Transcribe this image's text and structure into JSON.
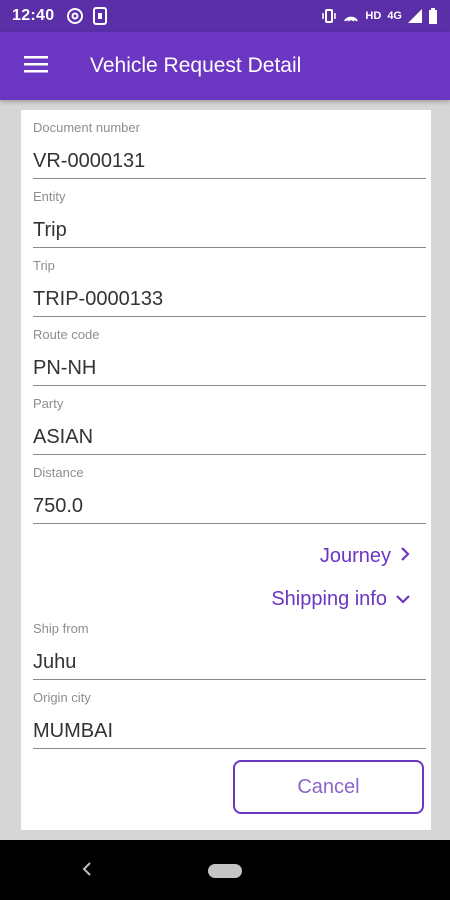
{
  "status": {
    "time": "12:40",
    "network": "HD",
    "network2": "4G"
  },
  "app_bar": {
    "title": "Vehicle Request Detail"
  },
  "fields": [
    {
      "label": "Document number",
      "value": "VR-0000131"
    },
    {
      "label": "Entity",
      "value": "Trip"
    },
    {
      "label": "Trip",
      "value": "TRIP-0000133"
    },
    {
      "label": "Route code",
      "value": "PN-NH"
    },
    {
      "label": "Party",
      "value": "ASIAN"
    },
    {
      "label": "Distance",
      "value": "750.0"
    }
  ],
  "links": {
    "journey": "Journey",
    "shipping_info": "Shipping info"
  },
  "shipping_fields": [
    {
      "label": "Ship from",
      "value": "Juhu"
    },
    {
      "label": "Origin city",
      "value": "MUMBAI"
    }
  ],
  "actions": {
    "cancel": "Cancel"
  },
  "colors": {
    "primary": "#6a36c2",
    "status_bar": "#5a2fa8"
  },
  "icons": [
    "menu-icon",
    "chevron-right-icon",
    "chevron-down-icon",
    "back-icon"
  ]
}
